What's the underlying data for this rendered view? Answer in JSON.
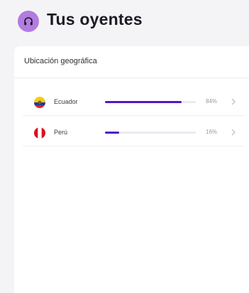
{
  "header": {
    "title": "Tus oyentes",
    "icon": "headphones-icon",
    "accent": "#b27ce0"
  },
  "card": {
    "section_title": "Ubicación geográfica",
    "rows": [
      {
        "country": "Ecuador",
        "percent_label": "84%",
        "share": 0.84,
        "flag": "ecuador-flag"
      },
      {
        "country": "Perú",
        "percent_label": "16%",
        "share": 0.16,
        "flag": "peru-flag"
      }
    ]
  },
  "colors": {
    "bar_fill": "#4f17c7",
    "bar_track": "#eceaf2"
  }
}
